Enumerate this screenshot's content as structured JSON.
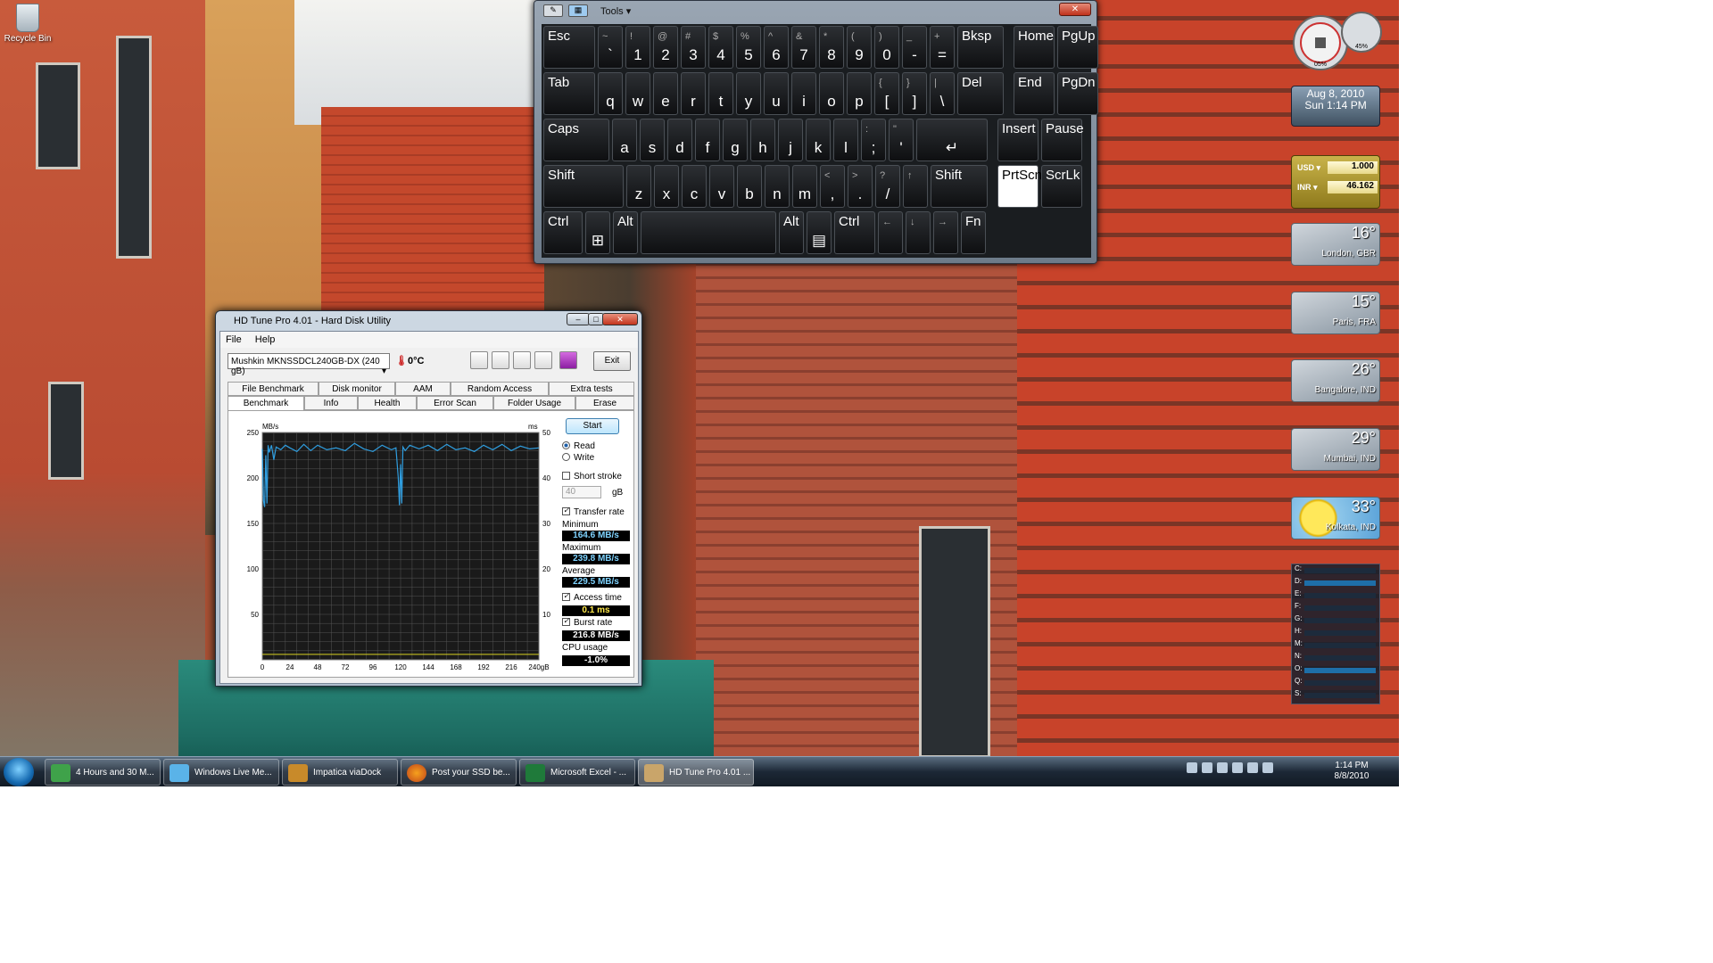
{
  "desktop": {
    "recycle_bin": "Recycle Bin"
  },
  "osk": {
    "tools": "Tools",
    "rows": [
      [
        {
          "t": "",
          "b": "Esc",
          "w": 58
        },
        {
          "t": "~",
          "b": "`",
          "w": 28
        },
        {
          "t": "!",
          "b": "1",
          "w": 28
        },
        {
          "t": "@",
          "b": "2",
          "w": 28
        },
        {
          "t": "#",
          "b": "3",
          "w": 28
        },
        {
          "t": "$",
          "b": "4",
          "w": 28
        },
        {
          "t": "%",
          "b": "5",
          "w": 28
        },
        {
          "t": "^",
          "b": "6",
          "w": 28
        },
        {
          "t": "&",
          "b": "7",
          "w": 28
        },
        {
          "t": "*",
          "b": "8",
          "w": 28
        },
        {
          "t": "(",
          "b": "9",
          "w": 28
        },
        {
          "t": ")",
          "b": "0",
          "w": 28
        },
        {
          "t": "_",
          "b": "-",
          "w": 28
        },
        {
          "t": "+",
          "b": "=",
          "w": 28
        },
        {
          "t": "",
          "b": "Bksp",
          "w": 52
        },
        {
          "t": "",
          "b": "Home",
          "w": 46,
          "gap": 8
        },
        {
          "t": "",
          "b": "PgUp",
          "w": 46
        }
      ],
      [
        {
          "t": "",
          "b": "Tab",
          "w": 58
        },
        {
          "t": "",
          "b": "q",
          "w": 28
        },
        {
          "t": "",
          "b": "w",
          "w": 28
        },
        {
          "t": "",
          "b": "e",
          "w": 28
        },
        {
          "t": "",
          "b": "r",
          "w": 28
        },
        {
          "t": "",
          "b": "t",
          "w": 28
        },
        {
          "t": "",
          "b": "y",
          "w": 28
        },
        {
          "t": "",
          "b": "u",
          "w": 28
        },
        {
          "t": "",
          "b": "i",
          "w": 28
        },
        {
          "t": "",
          "b": "o",
          "w": 28
        },
        {
          "t": "",
          "b": "p",
          "w": 28
        },
        {
          "t": "{",
          "b": "[",
          "w": 28
        },
        {
          "t": "}",
          "b": "]",
          "w": 28
        },
        {
          "t": "|",
          "b": "\\",
          "w": 28
        },
        {
          "t": "",
          "b": "Del",
          "w": 52
        },
        {
          "t": "",
          "b": "End",
          "w": 46,
          "gap": 8
        },
        {
          "t": "",
          "b": "PgDn",
          "w": 46
        }
      ],
      [
        {
          "t": "",
          "b": "Caps",
          "w": 74
        },
        {
          "t": "",
          "b": "a",
          "w": 28
        },
        {
          "t": "",
          "b": "s",
          "w": 28
        },
        {
          "t": "",
          "b": "d",
          "w": 28
        },
        {
          "t": "",
          "b": "f",
          "w": 28
        },
        {
          "t": "",
          "b": "g",
          "w": 28
        },
        {
          "t": "",
          "b": "h",
          "w": 28
        },
        {
          "t": "",
          "b": "j",
          "w": 28
        },
        {
          "t": "",
          "b": "k",
          "w": 28
        },
        {
          "t": "",
          "b": "l",
          "w": 28
        },
        {
          "t": ":",
          "b": ";",
          "w": 28
        },
        {
          "t": "\"",
          "b": "'",
          "w": 28
        },
        {
          "t": "",
          "b": "↵",
          "w": 80
        },
        {
          "t": "",
          "b": "Insert",
          "w": 46,
          "gap": 8
        },
        {
          "t": "",
          "b": "Pause",
          "w": 46
        }
      ],
      [
        {
          "t": "",
          "b": "Shift",
          "w": 90
        },
        {
          "t": "",
          "b": "z",
          "w": 28
        },
        {
          "t": "",
          "b": "x",
          "w": 28
        },
        {
          "t": "",
          "b": "c",
          "w": 28
        },
        {
          "t": "",
          "b": "v",
          "w": 28
        },
        {
          "t": "",
          "b": "b",
          "w": 28
        },
        {
          "t": "",
          "b": "n",
          "w": 28
        },
        {
          "t": "",
          "b": "m",
          "w": 28
        },
        {
          "t": "<",
          "b": ",",
          "w": 28
        },
        {
          "t": ">",
          "b": ".",
          "w": 28
        },
        {
          "t": "?",
          "b": "/",
          "w": 28
        },
        {
          "t": "↑",
          "b": "",
          "w": 28
        },
        {
          "t": "",
          "b": "Shift",
          "w": 64
        },
        {
          "t": "",
          "b": "PrtScn",
          "w": 46,
          "gap": 8,
          "hl": true
        },
        {
          "t": "",
          "b": "ScrLk",
          "w": 46
        }
      ],
      [
        {
          "t": "",
          "b": "Ctrl",
          "w": 44
        },
        {
          "t": "",
          "b": "⊞",
          "w": 28
        },
        {
          "t": "",
          "b": "Alt",
          "w": 28
        },
        {
          "t": "",
          "b": "",
          "w": 152
        },
        {
          "t": "",
          "b": "Alt",
          "w": 28
        },
        {
          "t": "",
          "b": "▤",
          "w": 28
        },
        {
          "t": "",
          "b": "Ctrl",
          "w": 46
        },
        {
          "t": "←",
          "b": "",
          "w": 28
        },
        {
          "t": "↓",
          "b": "",
          "w": 28
        },
        {
          "t": "→",
          "b": "",
          "w": 28
        },
        {
          "t": "",
          "b": "Fn",
          "w": 28
        }
      ]
    ]
  },
  "hdtune": {
    "title": "HD Tune Pro 4.01 - Hard Disk Utility",
    "menu": [
      "File",
      "Help"
    ],
    "drive": "Mushkin MKNSSDCL240GB-DX (240 gB)",
    "temp": "0°C",
    "exit": "Exit",
    "tabs_top": [
      "File Benchmark",
      "Disk monitor",
      "AAM",
      "Random Access",
      "Extra tests"
    ],
    "tabs_bottom": [
      "Benchmark",
      "Info",
      "Health",
      "Error Scan",
      "Folder Usage",
      "Erase"
    ],
    "start": "Start",
    "read": "Read",
    "write": "Write",
    "short_stroke": "Short stroke",
    "stroke_val": "40",
    "stroke_unit": "gB",
    "transfer_rate": "Transfer rate",
    "minimum_label": "Minimum",
    "minimum": "164.6 MB/s",
    "maximum_label": "Maximum",
    "maximum": "239.8 MB/s",
    "average_label": "Average",
    "average": "229.5 MB/s",
    "access_label": "Access time",
    "access": "0.1 ms",
    "burst_label": "Burst rate",
    "burst": "216.8 MB/s",
    "cpu_label": "CPU usage",
    "cpu": "-1.0%"
  },
  "chart_data": {
    "type": "line",
    "ylabel_left": "MB/s",
    "ylabel_right": "ms",
    "x_ticks": [
      "0",
      "24",
      "48",
      "72",
      "96",
      "120",
      "144",
      "168",
      "192",
      "216",
      "240gB"
    ],
    "y_left_ticks": [
      "250",
      "200",
      "150",
      "100",
      "50"
    ],
    "y_right_ticks": [
      "50",
      "40",
      "30",
      "20",
      "10"
    ],
    "ylim": [
      0,
      250
    ],
    "xlim": [
      0,
      240
    ],
    "series": [
      {
        "color": "#2f9ee0",
        "x": [
          0,
          1,
          2,
          3,
          4,
          5,
          6,
          8,
          10,
          12,
          16,
          20,
          24,
          30,
          36,
          42,
          48,
          56,
          64,
          72,
          80,
          88,
          96,
          104,
          112,
          116,
          118,
          119,
          120,
          121,
          122,
          124,
          128,
          136,
          144,
          152,
          160,
          168,
          176,
          184,
          192,
          200,
          208,
          216,
          224,
          232,
          240
        ],
        "values": [
          232,
          175,
          168,
          225,
          172,
          236,
          228,
          236,
          220,
          234,
          231,
          236,
          233,
          229,
          237,
          230,
          236,
          231,
          233,
          230,
          238,
          232,
          229,
          236,
          231,
          233,
          200,
          170,
          215,
          172,
          234,
          230,
          236,
          232,
          236,
          230,
          237,
          231,
          233,
          229,
          236,
          231,
          237,
          230,
          235,
          232,
          233
        ]
      },
      {
        "color": "#d8d020",
        "x": [
          0,
          24,
          48,
          72,
          96,
          120,
          144,
          168,
          192,
          216,
          240
        ],
        "values": [
          6,
          6,
          6,
          6,
          6,
          6,
          6,
          6,
          6,
          6,
          6
        ]
      }
    ]
  },
  "gadgets": {
    "meter_cpu": "05%",
    "meter_ram": "45%",
    "date": "Aug 8, 2010",
    "time": "Sun 1:14 PM",
    "usd_label": "USD",
    "usd": "1.000",
    "inr_label": "INR",
    "inr": "46.162",
    "weather": [
      {
        "temp": "16°",
        "city": "London, GBR"
      },
      {
        "temp": "15°",
        "city": "Paris, FRA"
      },
      {
        "temp": "26°",
        "city": "Bangalore, IND"
      },
      {
        "temp": "29°",
        "city": "Mumbai, IND"
      },
      {
        "temp": "33°",
        "city": "Kolkata, IND"
      }
    ],
    "drives": [
      "C:",
      "D:",
      "E:",
      "F:",
      "G:",
      "H:",
      "M:",
      "N:",
      "O:",
      "Q:",
      "S:"
    ]
  },
  "taskbar": {
    "items": [
      "4 Hours and 30 M...",
      "Windows Live Me...",
      "Impatica viaDock",
      "Post your SSD be...",
      "Microsoft Excel - ...",
      "HD Tune Pro 4.01 ..."
    ],
    "time": "1:14 PM",
    "date": "8/8/2010"
  }
}
